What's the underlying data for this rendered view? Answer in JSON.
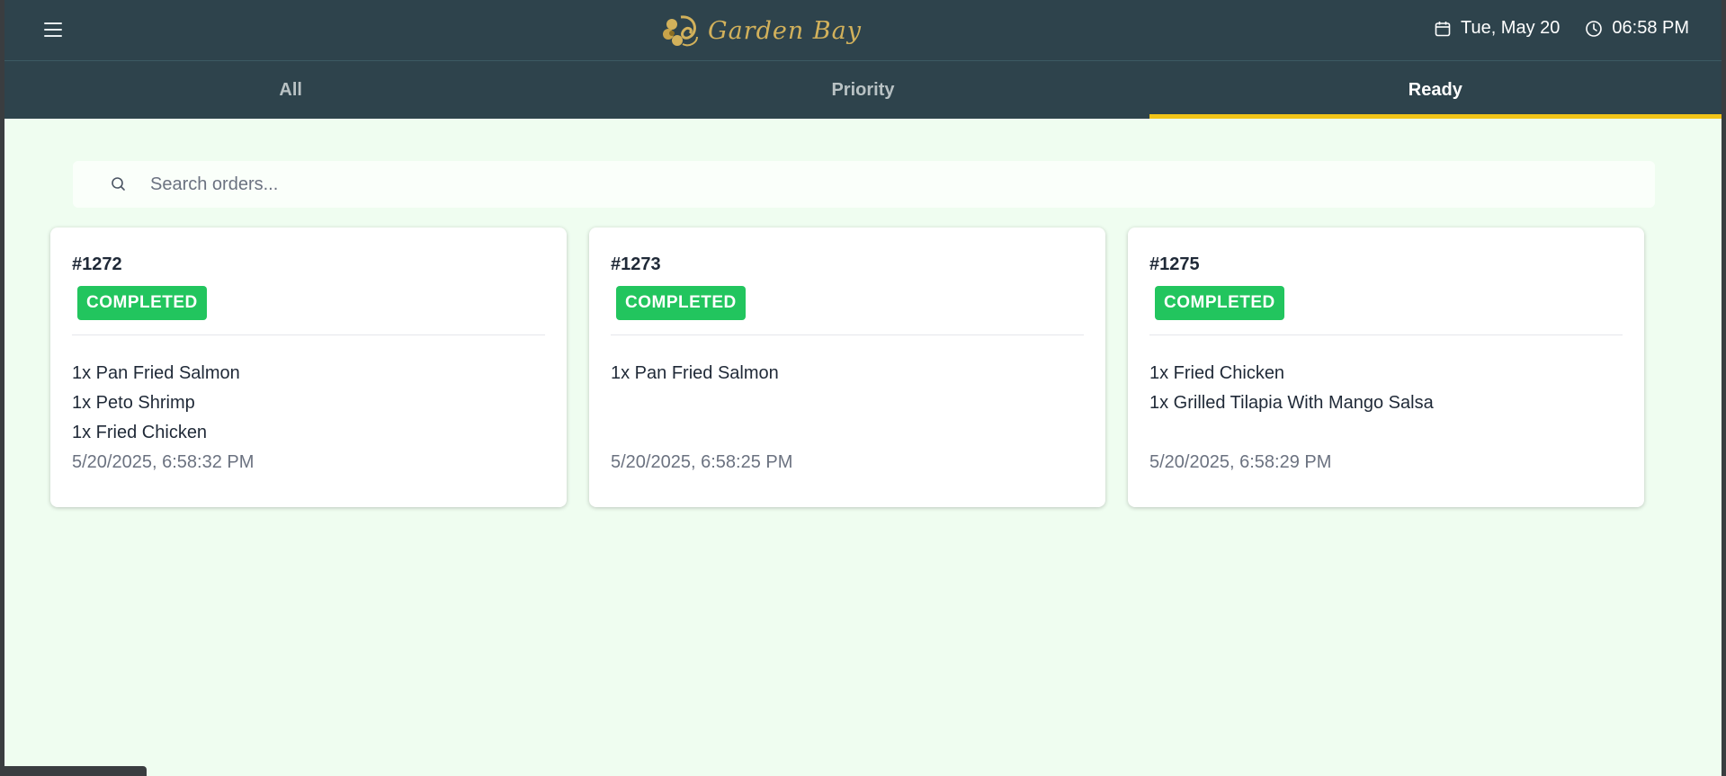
{
  "header": {
    "brand": "Garden Bay",
    "date": "Tue, May 20",
    "time": "06:58 PM"
  },
  "tabs": [
    {
      "label": "All",
      "active": false
    },
    {
      "label": "Priority",
      "active": false
    },
    {
      "label": "Ready",
      "active": true
    }
  ],
  "search": {
    "placeholder": "Search orders...",
    "value": ""
  },
  "orders": [
    {
      "id": "#1272",
      "status": "COMPLETED",
      "items": [
        "1x Pan Fried Salmon",
        "1x Peto Shrimp",
        "1x Fried Chicken"
      ],
      "timestamp": "5/20/2025, 6:58:32 PM"
    },
    {
      "id": "#1273",
      "status": "COMPLETED",
      "items": [
        "1x Pan Fried Salmon"
      ],
      "timestamp": "5/20/2025, 6:58:25 PM"
    },
    {
      "id": "#1275",
      "status": "COMPLETED",
      "items": [
        "1x Fried Chicken",
        "1x Grilled Tilapia With Mango Salsa"
      ],
      "timestamp": "5/20/2025, 6:58:29 PM"
    }
  ],
  "colors": {
    "header_bg": "#2e434c",
    "page_bg": "#effdf0",
    "accent": "#f2c418",
    "completed": "#22c55e",
    "brand_gold": "#d2b15b"
  },
  "icons": {
    "menu": "hamburger-menu-icon",
    "logo": "flower-logo-icon",
    "date": "calendar-icon",
    "time": "clock-icon",
    "search": "search-icon"
  }
}
